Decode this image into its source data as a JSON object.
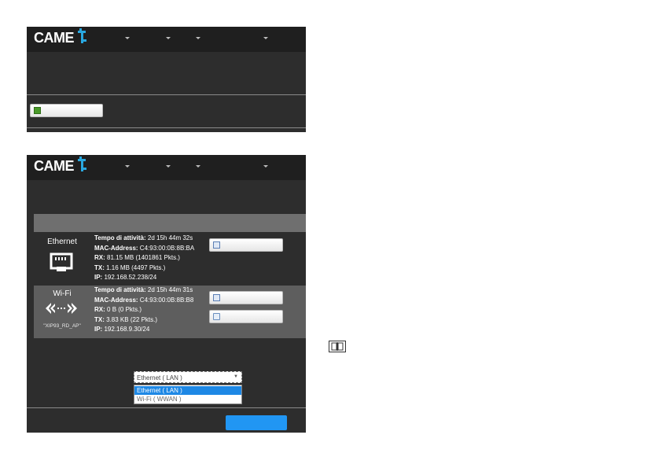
{
  "brand": {
    "logo_text": "CAME"
  },
  "panel_top": {},
  "panel_bottom": {
    "interfaces": [
      {
        "name": "Ethernet",
        "ssid": "",
        "info": [
          {
            "label": "Tempo di attività:",
            "value": "2d 15h 44m 32s"
          },
          {
            "label": "MAC-Address:",
            "value": "C4:93:00:0B:8B:BA"
          },
          {
            "label": "RX:",
            "value": "81.15 MB (1401861 Pkts.)"
          },
          {
            "label": "TX:",
            "value": "1.16 MB (4497 Pkts.)"
          },
          {
            "label": "IP:",
            "value": "192.168.52.238/24"
          }
        ]
      },
      {
        "name": "Wi-Fi",
        "ssid": "\"XIP93_RD_AP\"",
        "info": [
          {
            "label": "Tempo di attività:",
            "value": "2d 15h 44m 31s"
          },
          {
            "label": "MAC-Address:",
            "value": "C4:93:00:0B:8B:B8"
          },
          {
            "label": "RX:",
            "value": "0 B (0 Pkts.)"
          },
          {
            "label": "TX:",
            "value": "3.83 KB (22 Pkts.)"
          },
          {
            "label": "IP:",
            "value": "192.168.9.30/24"
          }
        ]
      }
    ],
    "select": {
      "value": "Ethernet ( LAN )",
      "options": [
        "Ethernet ( LAN )",
        "Wi-Fi ( WWAN )"
      ]
    }
  },
  "colors": {
    "panel_bg": "#2d2d2d",
    "topbar_bg": "#1f1f1f",
    "accent_blue": "#2196f3",
    "logo_mark": "#29a8e0"
  }
}
